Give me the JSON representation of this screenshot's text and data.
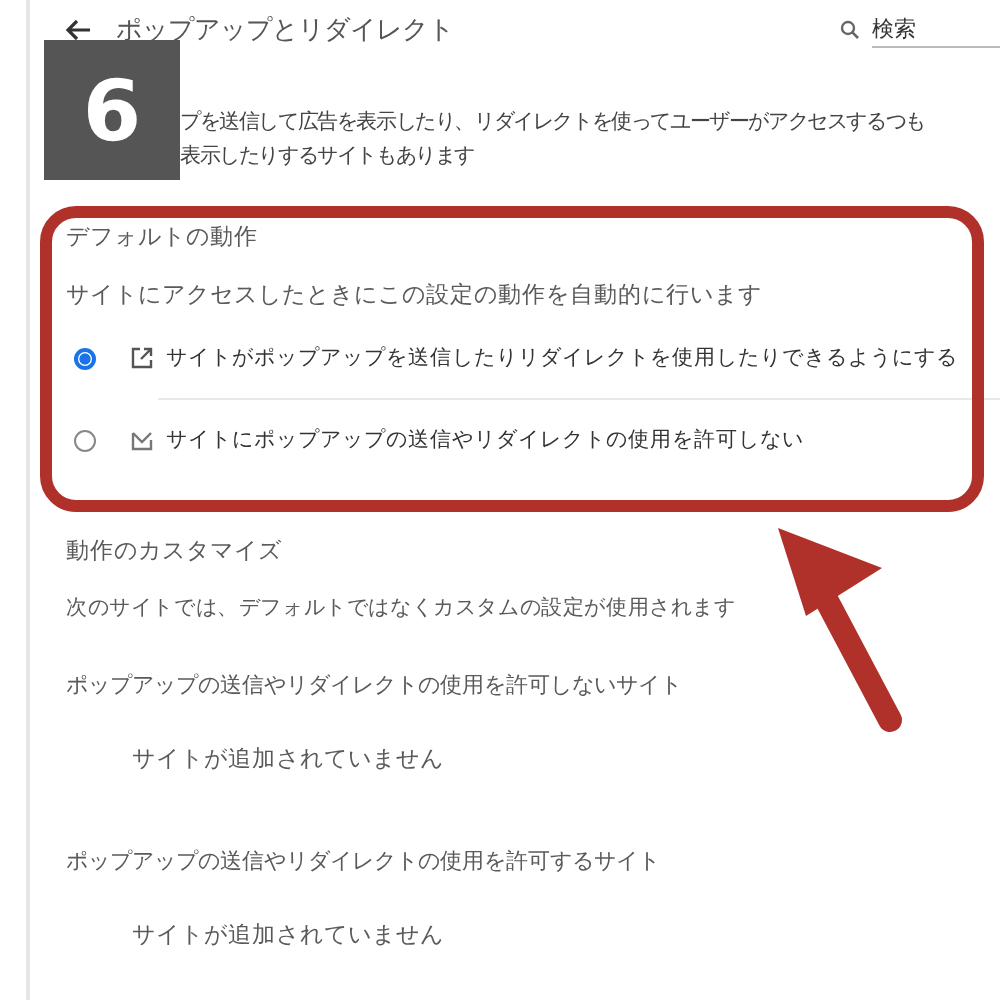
{
  "header": {
    "title": "ポップアップとリダイレクト",
    "search": {
      "placeholder": "検索"
    }
  },
  "annotation": {
    "step": "6"
  },
  "description": [
    "プを送信して広告を表示したり、リダイレクトを使ってユーザーがアクセスするつも",
    "表示したりするサイトもあります"
  ],
  "default_behavior": {
    "heading": "デフォルトの動作",
    "subtitle": "サイトにアクセスしたときにこの設定の動作を自動的に行います",
    "options": [
      {
        "kind": "allow",
        "label": "サイトがポップアップを送信したりリダイレクトを使用したりできるようにする",
        "selected": true
      },
      {
        "kind": "block",
        "label": "サイトにポップアップの送信やリダイレクトの使用を許可しない",
        "selected": false
      }
    ]
  },
  "customize": {
    "heading": "動作のカスタマイズ",
    "subtitle": "次のサイトでは、デフォルトではなくカスタムの設定が使用されます",
    "lists": [
      {
        "heading": "ポップアップの送信やリダイレクトの使用を許可しないサイト",
        "empty": "サイトが追加されていません"
      },
      {
        "heading": "ポップアップの送信やリダイレクトの使用を許可するサイト",
        "empty": "サイトが追加されていません"
      }
    ]
  }
}
